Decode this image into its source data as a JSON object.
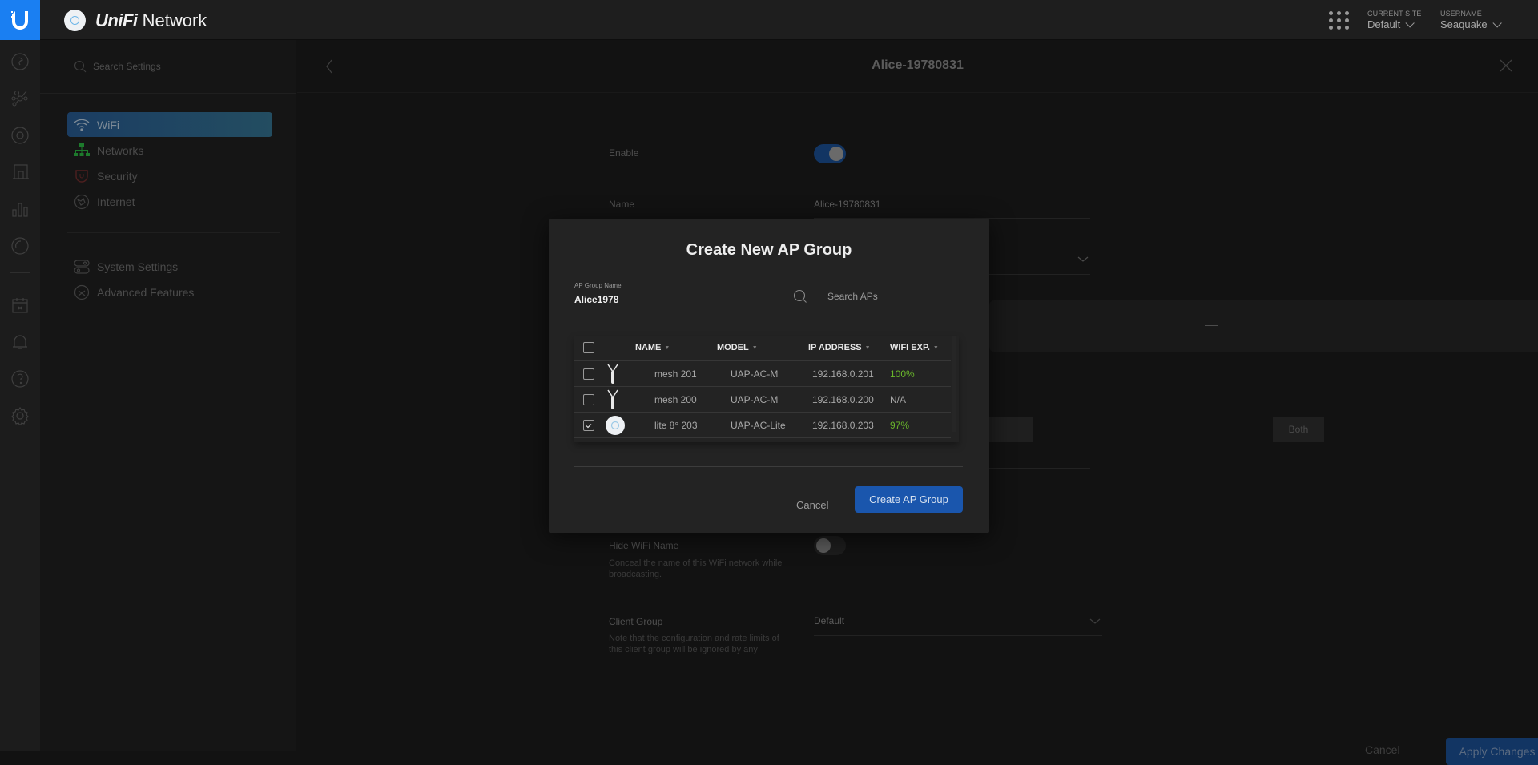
{
  "app": {
    "brand_prefix": "UniFi",
    "brand_suffix": " Network",
    "current_site_label": "CURRENT SITE",
    "current_site_value": "Default",
    "username_label": "USERNAME",
    "username_value": "Seaquake"
  },
  "iconbar": {
    "items": [
      "dashboard-icon",
      "topology-icon",
      "devices-icon",
      "clients-icon",
      "statistics-icon",
      "insights-icon",
      "events-icon",
      "alerts-icon",
      "support-icon",
      "settings-icon"
    ]
  },
  "settings_nav": {
    "search_placeholder": "Search Settings",
    "items": [
      {
        "label": "WiFi",
        "active": true
      },
      {
        "label": "Networks",
        "active": false
      },
      {
        "label": "Security",
        "active": false
      },
      {
        "label": "Internet",
        "active": false
      }
    ],
    "secondary_items": [
      {
        "label": "System Settings"
      },
      {
        "label": "Advanced Features"
      }
    ]
  },
  "main": {
    "title": "Alice-19780831",
    "form": {
      "enable_label": "Enable",
      "enable_on": true,
      "name_label": "Name",
      "name_value": "Alice-19780831",
      "band_option_visible": "Both",
      "hide_wifi_label": "Hide WiFi Name",
      "hide_wifi_desc": "Conceal the name of this WiFi network while broadcasting.",
      "hide_wifi_on": false,
      "client_group_label": "Client Group",
      "client_group_value": "Default",
      "client_group_desc": "Note that the configuration and rate limits of this client group will be ignored by any",
      "cancel_label": "Cancel",
      "apply_label": "Apply Changes"
    }
  },
  "modal": {
    "title": "Create New AP Group",
    "group_name_label": "AP Group Name",
    "group_name_value": "Alice1978",
    "search_placeholder": "Search APs",
    "columns": [
      "NAME",
      "MODEL",
      "IP ADDRESS",
      "WIFI EXP."
    ],
    "rows": [
      {
        "checked": false,
        "device": "mesh-ap-icon",
        "name": "mesh 201",
        "model": "UAP-AC-M",
        "ip": "192.168.0.201",
        "wifi_exp": "100%",
        "exp_status": "good"
      },
      {
        "checked": false,
        "device": "mesh-ap-icon",
        "name": "mesh 200",
        "model": "UAP-AC-M",
        "ip": "192.168.0.200",
        "wifi_exp": "N/A",
        "exp_status": "none"
      },
      {
        "checked": true,
        "device": "lite-ap-icon",
        "name": "lite 8° 203",
        "model": "UAP-AC-Lite",
        "ip": "192.168.0.203",
        "wifi_exp": "97%",
        "exp_status": "good"
      }
    ],
    "cancel_label": "Cancel",
    "create_label": "Create AP Group"
  },
  "colors": {
    "accent": "#1a7ff2",
    "primary_button": "#1a56ad",
    "good": "#6ab82b"
  }
}
